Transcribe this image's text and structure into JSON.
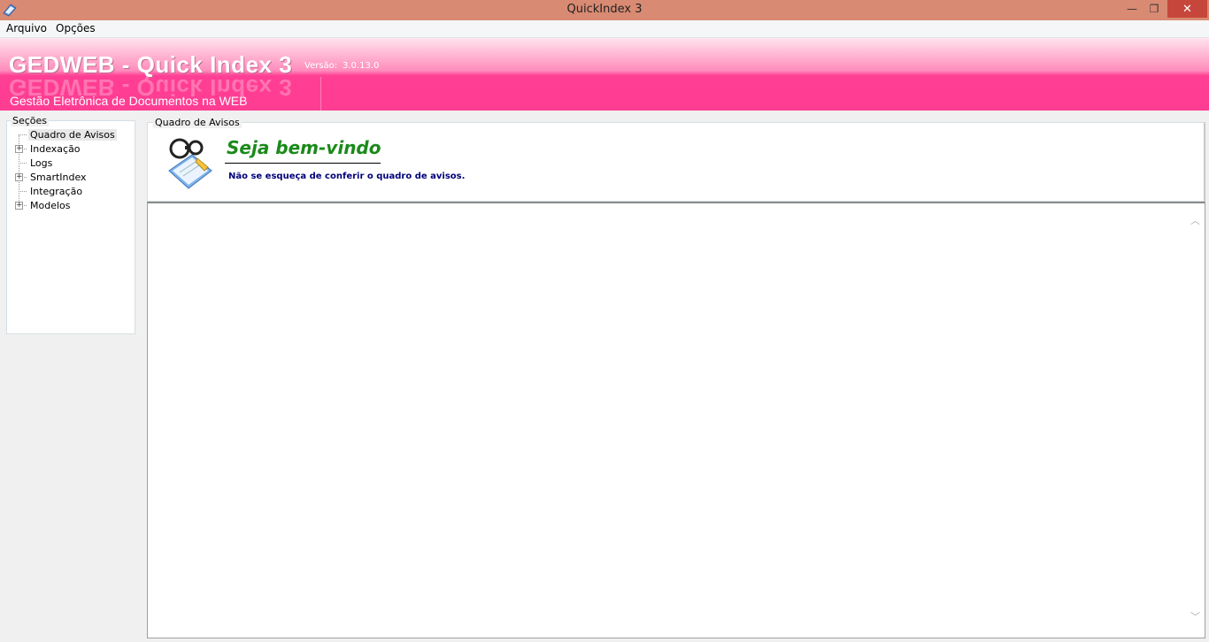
{
  "window": {
    "title": "QuickIndex 3",
    "minimize_glyph": "—",
    "maximize_glyph": "❐",
    "close_glyph": "✕"
  },
  "menu": {
    "items": [
      "Arquivo",
      "Opções"
    ]
  },
  "banner": {
    "title": "GEDWEB - Quick Index 3",
    "version_label": "Versão:",
    "version_value": "3.0.13.0",
    "subtitle": "Gestão Eletrônica de Documentos na WEB"
  },
  "sections": {
    "caption": "Seções",
    "items": [
      {
        "label": "Quadro de Avisos",
        "expandable": false,
        "selected": true
      },
      {
        "label": "Indexação",
        "expandable": true,
        "selected": false
      },
      {
        "label": "Logs",
        "expandable": false,
        "selected": false
      },
      {
        "label": "SmartIndex",
        "expandable": true,
        "selected": false
      },
      {
        "label": "Integração",
        "expandable": false,
        "selected": false
      },
      {
        "label": "Modelos",
        "expandable": true,
        "selected": false
      }
    ],
    "expander_glyph": "+"
  },
  "notices": {
    "caption": "Quadro de Avisos",
    "welcome_title": "Seja bem-vindo",
    "welcome_message": "Não se esqueça de conferir o quadro de avisos.",
    "icon": "magnifier-document-icon"
  },
  "content": {
    "scroll_up_glyph": "︿",
    "scroll_down_glyph": "﹀"
  },
  "colors": {
    "titlebar": "#d98a72",
    "close_button": "#c7463c",
    "banner_pink": "#ff3d93",
    "welcome_green": "#1a8a1a",
    "welcome_msg_blue": "#00007a"
  }
}
